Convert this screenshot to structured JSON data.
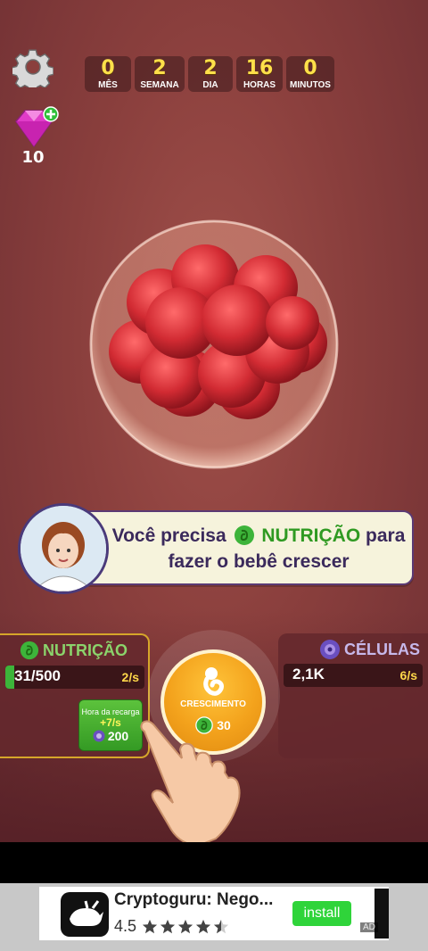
{
  "timer": [
    {
      "value": "0",
      "label": "MÊS"
    },
    {
      "value": "2",
      "label": "SEMANA"
    },
    {
      "value": "2",
      "label": "DIA"
    },
    {
      "value": "16",
      "label": "HORAS"
    },
    {
      "value": "0",
      "label": "MINUTOS"
    }
  ],
  "gems": {
    "count": "10"
  },
  "speech": {
    "part1": "Você precisa",
    "highlight": "NUTRIÇÃO",
    "part2": "para",
    "line2": "fazer o bebê crescer"
  },
  "nutrition": {
    "title": "NUTRIÇÃO",
    "value": "31/500",
    "fill_fraction": 0.062,
    "rate": "2/s",
    "recharge": {
      "title": "Hora da recarga",
      "rate": "+7/s",
      "cost": "200"
    }
  },
  "cells": {
    "title": "CÉLULAS",
    "value": "2,1K",
    "rate": "6/s"
  },
  "grow_button": {
    "label": "CRESCIMENTO",
    "cost": "30"
  },
  "ad": {
    "title": "Cryptoguru: Nego...",
    "rating": "4.5",
    "stars": 4.5,
    "install": "install",
    "tag": "AD"
  },
  "colors": {
    "nutrition": "#3db43a",
    "cells": "#7b5fc9",
    "accent_gold": "#ffe04a"
  },
  "icons": [
    "gear-icon",
    "gem-icon",
    "plus-icon",
    "nutrition-icon",
    "cell-icon",
    "fetus-icon",
    "hand-pointer-icon",
    "star-icon"
  ]
}
